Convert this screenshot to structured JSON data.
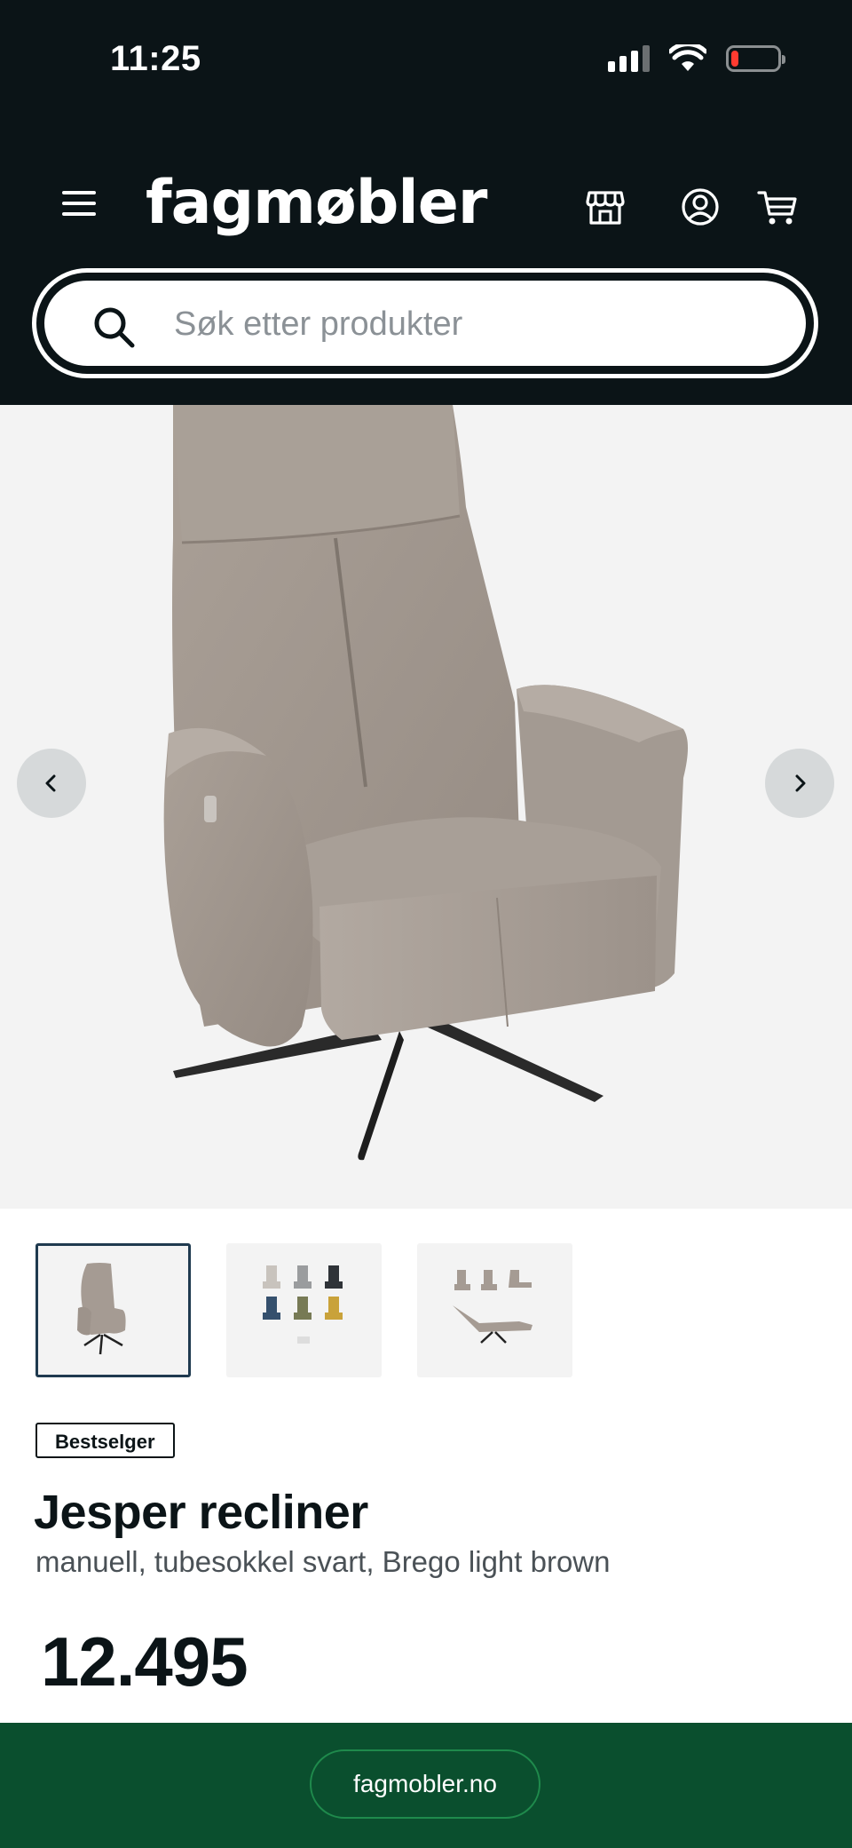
{
  "status_bar": {
    "time": "11:25",
    "signal_bars": 3,
    "signal_bars_total": 4,
    "battery_level": 0.1,
    "icons": [
      "cellular-signal-icon",
      "wifi-icon",
      "battery-low-icon"
    ]
  },
  "header": {
    "logo": "fagmøbler",
    "icons": [
      "menu-icon",
      "store-icon",
      "account-icon",
      "cart-icon"
    ]
  },
  "search": {
    "placeholder": "Søk etter produkter",
    "icon": "search-icon"
  },
  "gallery": {
    "prev_icon": "chevron-left-icon",
    "next_icon": "chevron-right-icon",
    "thumbnail_count": 3,
    "active_thumbnail": 1
  },
  "product": {
    "badge": "Bestselger",
    "title": "Jesper recliner",
    "subtitle": "manuell, tubesokkel svart, Brego light brown",
    "price": "12.495"
  },
  "footer": {
    "domain": "fagmobler.no"
  },
  "colors": {
    "header_bg": "#0b1417",
    "footer_bg": "#0a4f2e",
    "accent_green": "#1f8a4c",
    "chair_fabric": "#a59b93"
  }
}
